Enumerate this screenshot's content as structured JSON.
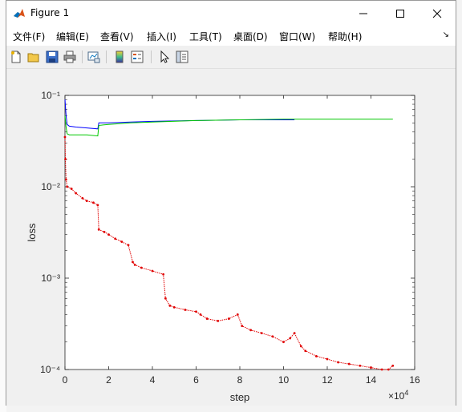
{
  "window": {
    "title": "Figure 1"
  },
  "menu": [
    "文件(F)",
    "编辑(E)",
    "查看(V)",
    "插入(I)",
    "工具(T)",
    "桌面(D)",
    "窗口(W)",
    "帮助(H)"
  ],
  "colors": {
    "accent": "#0072bd",
    "series_blue": "#0000ff",
    "series_green": "#00c800",
    "series_red": "#e00000",
    "axes_bg": "#ffffff"
  },
  "toolbar_icons": [
    "new-figure-icon",
    "open-file-icon",
    "save-icon",
    "print-icon",
    "link-plot-icon",
    "colorbar-icon",
    "legend-icon",
    "pointer-icon",
    "property-inspector-icon"
  ],
  "chart_data": {
    "type": "line",
    "xlabel": "step",
    "ylabel": "loss",
    "x_exponent_label": "×10⁴",
    "x_exponent": "4",
    "xlim": [
      0,
      16
    ],
    "ylim": [
      0.0001,
      0.1
    ],
    "yscale": "log",
    "xticks": [
      "0",
      "2",
      "4",
      "6",
      "8",
      "10",
      "12",
      "14",
      "16"
    ],
    "yticks": [
      "10⁻⁴",
      "10⁻³",
      "10⁻²",
      "10⁻¹"
    ],
    "x_units_note": "x values in units of 10^4 steps",
    "series": [
      {
        "color": "#0000ff",
        "x": [
          0,
          0.05,
          0.1,
          0.2,
          0.5,
          1.0,
          1.5,
          1.55,
          2.0,
          3.0,
          4.0,
          6.0,
          8.0,
          10.0,
          10.5
        ],
        "y": [
          0.09,
          0.06,
          0.048,
          0.046,
          0.045,
          0.044,
          0.043,
          0.05,
          0.05,
          0.051,
          0.052,
          0.053,
          0.054,
          0.054,
          0.054
        ]
      },
      {
        "color": "#00c800",
        "x": [
          0,
          0.05,
          0.1,
          0.2,
          0.5,
          1.0,
          1.5,
          1.55,
          2.0,
          3.0,
          4.0,
          6.0,
          8.0,
          10.0,
          12.0,
          15.0
        ],
        "y": [
          0.06,
          0.045,
          0.038,
          0.037,
          0.037,
          0.037,
          0.036,
          0.047,
          0.048,
          0.05,
          0.051,
          0.053,
          0.054,
          0.055,
          0.055,
          0.055
        ]
      },
      {
        "color": "#e00000",
        "x": [
          0,
          0.02,
          0.05,
          0.1,
          0.3,
          0.5,
          0.8,
          1.0,
          1.3,
          1.5,
          1.55,
          1.8,
          2.0,
          2.3,
          2.6,
          2.9,
          3.1,
          3.2,
          3.5,
          4.0,
          4.5,
          4.6,
          4.8,
          5.0,
          5.5,
          6.0,
          6.2,
          6.5,
          7.0,
          7.5,
          7.9,
          8.1,
          8.5,
          9.0,
          9.5,
          10.0,
          10.3,
          10.5,
          10.8,
          11.0,
          11.5,
          12.0,
          12.5,
          13.0,
          13.5,
          14.0,
          14.5,
          14.8,
          15.0
        ],
        "y": [
          0.035,
          0.02,
          0.012,
          0.01,
          0.0095,
          0.0085,
          0.0075,
          0.007,
          0.0067,
          0.0063,
          0.0034,
          0.0032,
          0.003,
          0.0027,
          0.0025,
          0.0023,
          0.0015,
          0.0014,
          0.0013,
          0.0012,
          0.0011,
          0.0006,
          0.0005,
          0.00048,
          0.00045,
          0.00043,
          0.0004,
          0.00036,
          0.00034,
          0.00036,
          0.0004,
          0.0003,
          0.00027,
          0.00025,
          0.00023,
          0.0002,
          0.00022,
          0.00025,
          0.00018,
          0.00016,
          0.00014,
          0.00013,
          0.00012,
          0.000115,
          0.00011,
          0.000105,
          0.0001,
          0.0001,
          0.00011
        ]
      }
    ]
  }
}
